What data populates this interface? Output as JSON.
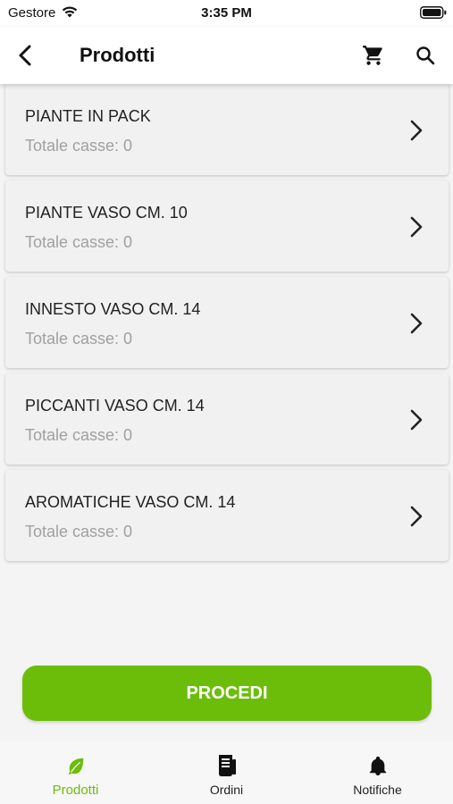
{
  "status_bar": {
    "carrier": "Gestore",
    "time": "3:35 PM"
  },
  "header": {
    "title": "Prodotti",
    "icons": [
      "back-arrow-icon",
      "cart-icon",
      "search-icon"
    ]
  },
  "products": [
    {
      "name": "PIANTE IN PACK",
      "subtitle": "Totale casse: 0"
    },
    {
      "name": "PIANTE VASO CM. 10",
      "subtitle": "Totale casse: 0"
    },
    {
      "name": "INNESTO VASO CM. 14",
      "subtitle": "Totale casse: 0"
    },
    {
      "name": "PICCANTI VASO CM. 14",
      "subtitle": "Totale casse: 0"
    },
    {
      "name": "AROMATICHE VASO CM. 14",
      "subtitle": "Totale casse: 0"
    }
  ],
  "proceed_label": "PROCEDI",
  "nav": {
    "items": [
      {
        "label": "Prodotti",
        "icon": "leaf-icon",
        "active": true
      },
      {
        "label": "Ordini",
        "icon": "receipt-icon",
        "active": false
      },
      {
        "label": "Notifiche",
        "icon": "bell-icon",
        "active": false
      }
    ]
  },
  "colors": {
    "accent": "#6cbd0a",
    "muted_text": "#a0a0a0",
    "card_bg": "#f1f1f1"
  }
}
